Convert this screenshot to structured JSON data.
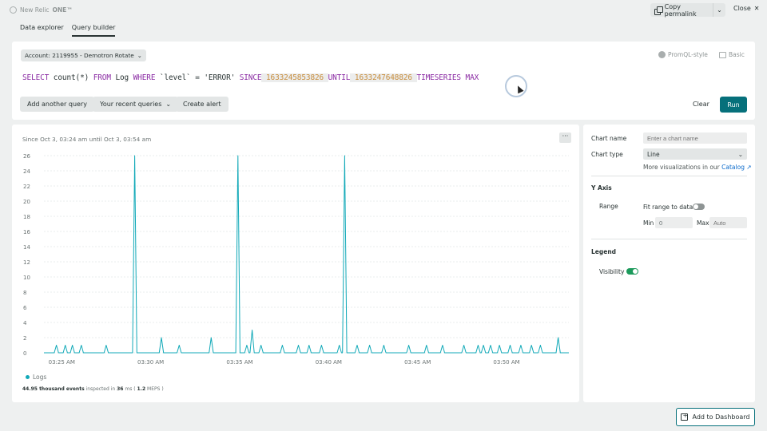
{
  "topbar": {
    "logo_text_a": "New Relic",
    "logo_text_b": "ONE™",
    "permalink_label": "Copy permalink",
    "permalink_caret": "⌄",
    "close_label": "Close",
    "close_glyph": "✕"
  },
  "tabs": [
    {
      "label": "Data explorer",
      "active": false
    },
    {
      "label": "Query builder",
      "active": true
    }
  ],
  "query": {
    "account_label": "Account: 2119955 - Demotron Rotate",
    "account_caret": "⌄",
    "promql_label": "PromQL-style",
    "basic_label": "Basic",
    "tokens": [
      {
        "t": "SELECT",
        "c": "kw"
      },
      {
        "t": " count(",
        "c": "fn"
      },
      {
        "t": "*",
        "c": "fn"
      },
      {
        "t": ") ",
        "c": "fn"
      },
      {
        "t": "FROM",
        "c": "kw"
      },
      {
        "t": " Log ",
        "c": "fn"
      },
      {
        "t": "WHERE",
        "c": "kw"
      },
      {
        "t": " `level` = 'ERROR' ",
        "c": "str"
      },
      {
        "t": "SINCE",
        "c": "kw"
      },
      {
        "t": " 1633245853826 ",
        "c": "num"
      },
      {
        "t": "UNTIL",
        "c": "kw"
      },
      {
        "t": " 1633247648826 ",
        "c": "num"
      },
      {
        "t": "TIMESERIES",
        "c": "kw"
      },
      {
        "t": " MAX",
        "c": "kw"
      }
    ],
    "add_another_label": "Add another query",
    "recent_label": "Your recent queries",
    "create_alert_label": "Create alert",
    "clear_label": "Clear",
    "run_label": "Run"
  },
  "chart": {
    "since_label": "Since Oct 3, 03:24 am until Oct 3, 03:54 am",
    "more_label": "···",
    "legend_label": "Logs",
    "stats_count": "44.95 thousand events",
    "stats_mid": " inspected in ",
    "stats_ms": "36",
    "stats_ms_unit": " ms ( ",
    "stats_rate": "1.2",
    "stats_rate_unit": " MEPS )"
  },
  "chart_data": {
    "type": "line",
    "title": "",
    "xlabel": "",
    "ylabel": "",
    "ylim": [
      0,
      26
    ],
    "yticks": [
      0,
      2,
      4,
      6,
      8,
      10,
      12,
      14,
      16,
      18,
      20,
      22,
      24,
      26
    ],
    "xlim": [
      0,
      29.5
    ],
    "xticks": [
      {
        "v": 1,
        "label": "03:25 AM"
      },
      {
        "v": 6,
        "label": "03:30 AM"
      },
      {
        "v": 11,
        "label": "03:35 AM"
      },
      {
        "v": 16,
        "label": "03:40 AM"
      },
      {
        "v": 21,
        "label": "03:45 AM"
      },
      {
        "v": 26,
        "label": "03:50 AM"
      }
    ],
    "grid": true,
    "series": [
      {
        "name": "Logs",
        "color": "#11a9b8",
        "spikes": [
          [
            0.7,
            1
          ],
          [
            1.2,
            1
          ],
          [
            1.6,
            1
          ],
          [
            2.1,
            1
          ],
          [
            3.5,
            1
          ],
          [
            5.1,
            26
          ],
          [
            6.6,
            2
          ],
          [
            7.6,
            1
          ],
          [
            9.4,
            2
          ],
          [
            10.9,
            26
          ],
          [
            11.4,
            1
          ],
          [
            11.7,
            3
          ],
          [
            12.2,
            1
          ],
          [
            13.4,
            1
          ],
          [
            14.3,
            1
          ],
          [
            14.9,
            1
          ],
          [
            15.6,
            1
          ],
          [
            16.6,
            1
          ],
          [
            16.9,
            26
          ],
          [
            17.6,
            1
          ],
          [
            18.3,
            1
          ],
          [
            19.1,
            1
          ],
          [
            20.5,
            1
          ],
          [
            21.5,
            1
          ],
          [
            22.4,
            1
          ],
          [
            23.6,
            1
          ],
          [
            24.4,
            1
          ],
          [
            24.7,
            1
          ],
          [
            25.1,
            1
          ],
          [
            25.6,
            1
          ],
          [
            26.2,
            1
          ],
          [
            26.8,
            1
          ],
          [
            27.4,
            1
          ],
          [
            27.9,
            1
          ],
          [
            28.9,
            2
          ]
        ]
      }
    ]
  },
  "settings": {
    "chart_name_label": "Chart name",
    "chart_name_placeholder": "Enter a chart name",
    "chart_type_label": "Chart type",
    "chart_type_value": "Line",
    "chart_type_caret": "⌄",
    "more_viz_text": "More visualizations in our ",
    "catalog_label": "Catalog",
    "catalog_glyph": "↗",
    "y_axis_heading": "Y Axis",
    "range_label": "Range",
    "fit_range_label": "Fit range to data",
    "fit_range_on": false,
    "min_label": "Min",
    "min_value": "0",
    "max_label": "Max",
    "max_placeholder": "Auto",
    "legend_heading": "Legend",
    "visibility_label": "Visibility",
    "visibility_on": true
  },
  "footer": {
    "add_dashboard_label": "Add to Dashboard"
  },
  "colors": {
    "accent": "#06707b",
    "series": "#11a9b8",
    "keyword": "#8a2aa3",
    "number": "#c98f3f",
    "toggle_on": "#1c9a5b",
    "toggle_off": "#8e9494"
  }
}
